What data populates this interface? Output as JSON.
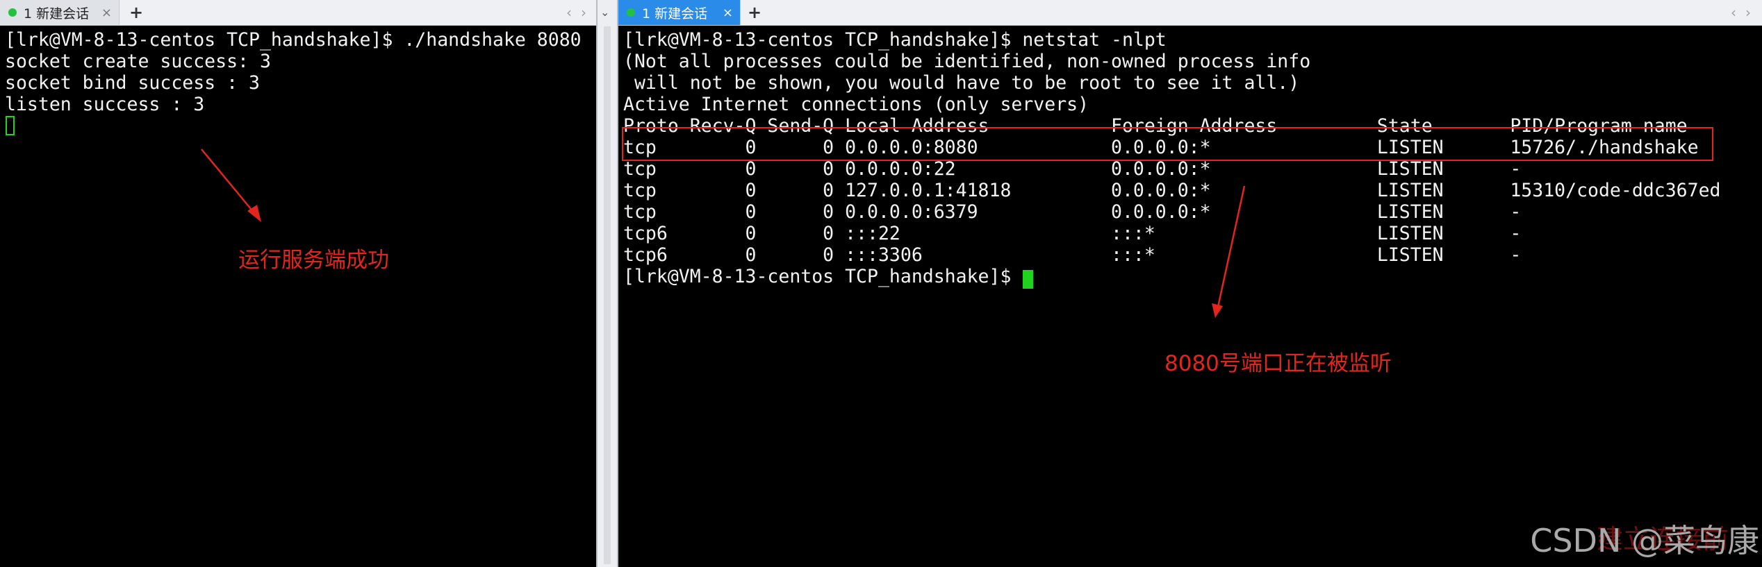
{
  "left_session": {
    "tab_label": "1 新建会话",
    "close_glyph": "×",
    "add_glyph": "+",
    "scroll_left": "‹",
    "scroll_right": "›",
    "menu_glyph": "⌄",
    "terminal_text": "[lrk@VM-8-13-centos TCP_handshake]$ ./handshake 8080\nsocket create success: 3\nsocket bind success : 3\nlisten success : 3",
    "annotation": "运行服务端成功"
  },
  "right_session": {
    "tab_label": "1 新建会话",
    "close_glyph": "×",
    "add_glyph": "+",
    "scroll_left": "‹",
    "scroll_right": "›",
    "terminal_text": "[lrk@VM-8-13-centos TCP_handshake]$ netstat -nlpt\n(Not all processes could be identified, non-owned process info\n will not be shown, you would have to be root to see it all.)\nActive Internet connections (only servers)\nProto Recv-Q Send-Q Local Address           Foreign Address         State       PID/Program name\ntcp        0      0 0.0.0.0:8080            0.0.0.0:*               LISTEN      15726/./handshake\ntcp        0      0 0.0.0.0:22              0.0.0.0:*               LISTEN      -\ntcp        0      0 127.0.0.1:41818         0.0.0.0:*               LISTEN      15310/code-ddc367ed\ntcp        0      0 0.0.0.0:6379            0.0.0.0:*               LISTEN      -\ntcp6       0      0 :::22                   :::*                    LISTEN      -\ntcp6       0      0 :::3306                 :::*                    LISTEN      -\n[lrk@VM-8-13-centos TCP_handshake]$ ",
    "annotation": "8080号端口正在被监听"
  },
  "watermark": {
    "text": "CSDN @菜鸟康",
    "overlay_text": "建立连接前"
  },
  "colors": {
    "annotation": "#e3251e",
    "cursor": "#1fd31f",
    "active_tab": "#2a8be8",
    "terminal_bg": "#000000"
  }
}
